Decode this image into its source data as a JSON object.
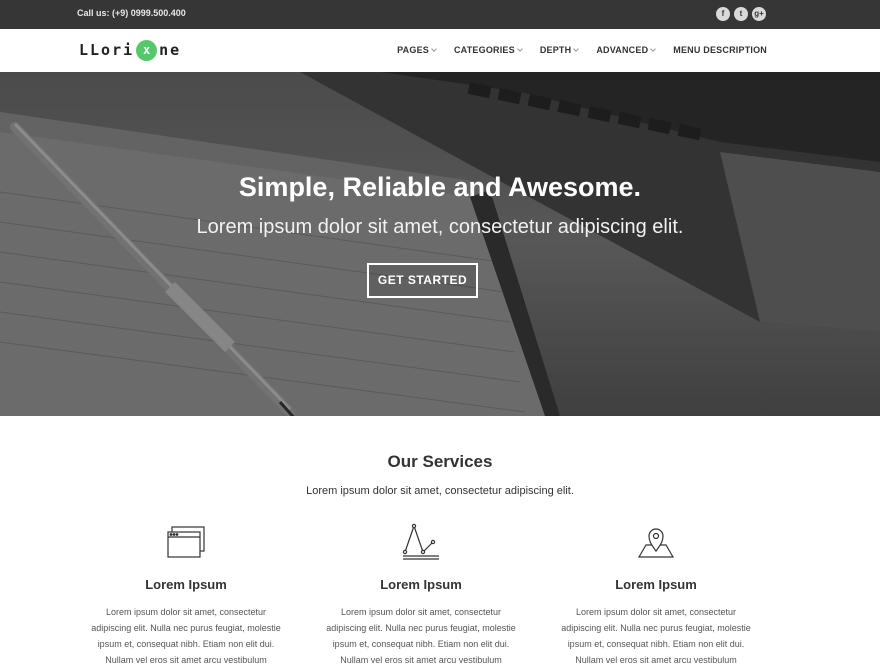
{
  "topbar": {
    "call": "Call us: (+9) 0999.500.400",
    "social": [
      {
        "icon": "facebook-icon",
        "glyph": "f"
      },
      {
        "icon": "twitter-icon",
        "glyph": "t"
      },
      {
        "icon": "google-plus-icon",
        "glyph": "g+"
      }
    ]
  },
  "header": {
    "logo_left": "LLori",
    "logo_mid": "x",
    "logo_right": "ne",
    "nav": [
      {
        "label": "PAGES",
        "dropdown": true
      },
      {
        "label": "CATEGORIES",
        "dropdown": true
      },
      {
        "label": "DEPTH",
        "dropdown": true
      },
      {
        "label": "ADVANCED",
        "dropdown": true
      },
      {
        "label": "MENU DESCRIPTION",
        "dropdown": false
      }
    ]
  },
  "hero": {
    "title": "Simple, Reliable and Awesome.",
    "subtitle": "Lorem ipsum dolor sit amet, consectetur adipiscing elit.",
    "button": "GET STARTED"
  },
  "services": {
    "title": "Our Services",
    "subtitle": "Lorem ipsum dolor sit amet, consectetur adipiscing elit.",
    "items": [
      {
        "icon": "browser-windows-icon",
        "title": "Lorem Ipsum",
        "text": "Lorem ipsum dolor sit amet, consectetur adipiscing elit. Nulla nec purus feugiat, molestie ipsum et, consequat nibh. Etiam non elit dui. Nullam vel eros sit amet arcu vestibulum"
      },
      {
        "icon": "line-graph-icon",
        "title": "Lorem Ipsum",
        "text": "Lorem ipsum dolor sit amet, consectetur adipiscing elit. Nulla nec purus feugiat, molestie ipsum et, consequat nibh. Etiam non elit dui. Nullam vel eros sit amet arcu vestibulum"
      },
      {
        "icon": "map-pin-icon",
        "title": "Lorem Ipsum",
        "text": "Lorem ipsum dolor sit amet, consectetur adipiscing elit. Nulla nec purus feugiat, molestie ipsum et, consequat nibh. Etiam non elit dui. Nullam vel eros sit amet arcu vestibulum"
      }
    ]
  },
  "colors": {
    "topbar_bg": "#363636",
    "accent_green": "#54c86a",
    "text_dark": "#333333"
  }
}
